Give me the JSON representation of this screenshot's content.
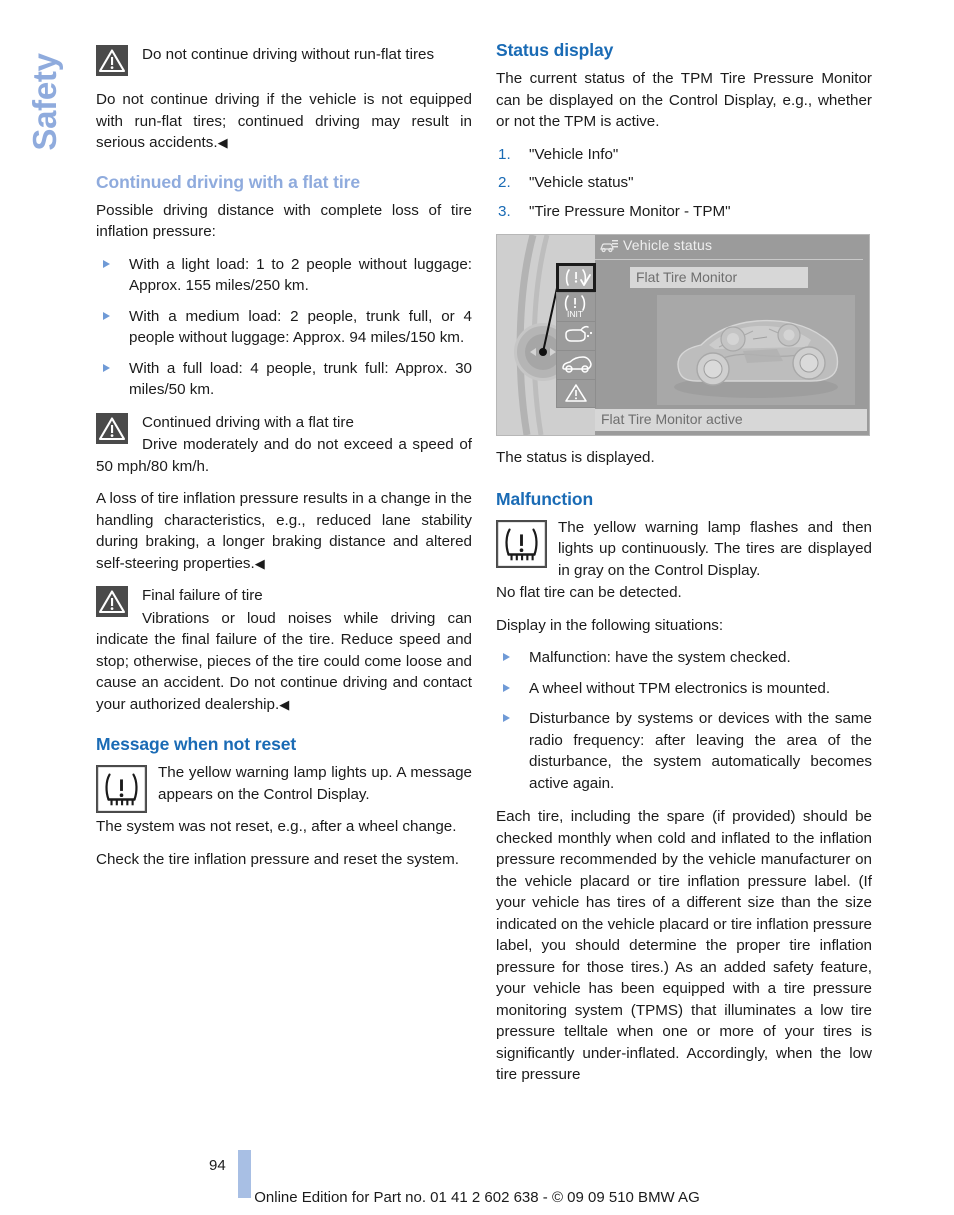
{
  "chapter_tab": {
    "label": "Safety"
  },
  "left_column": {
    "warning_runflat": {
      "icon": "warning-triangle-icon",
      "title": "Do not continue driving without run-flat tires",
      "body": "Do not continue driving if the vehicle is not equipped with run-flat tires; continued driving may result in serious accidents.",
      "endmark": "◀"
    },
    "heading_continued_driving": "Continued driving with a flat tire",
    "intro": "Possible driving distance with complete loss of tire inflation pressure:",
    "bullets": [
      "With a light load: 1 to 2 people without luggage: Approx. 155 miles/250 km.",
      "With a medium load: 2 people, trunk full, or 4 people without luggage: Approx. 94 miles/150 km.",
      "With a full load: 4 people, trunk full: Approx. 30 miles/50 km."
    ],
    "warning_continued": {
      "icon": "warning-triangle-icon",
      "title": "Continued driving with a flat tire",
      "body": "Drive moderately and do not exceed a speed of 50 mph/80 km/h."
    },
    "loss_paragraph": "A loss of tire inflation pressure results in a change in the handling characteristics, e.g., reduced lane stability during braking, a longer braking distance and altered self-steering properties.",
    "loss_endmark": "◀",
    "warning_final_failure": {
      "icon": "warning-triangle-icon",
      "title": "Final failure of tire",
      "body": "Vibrations or loud noises while driving can indicate the final failure of the tire. Reduce speed and stop; otherwise, pieces of the tire could come loose and cause an accident. Do not continue driving and contact your authorized dealership.",
      "endmark": "◀"
    },
    "heading_message_not_reset": "Message when not reset",
    "tpms_message": {
      "icon": "tpms-telltale-icon",
      "text": "The yellow warning lamp lights up. A message appears on the Control Display."
    },
    "not_reset_paragraph": "The system was not reset, e.g., after a wheel change.",
    "check_paragraph": "Check the tire inflation pressure and reset the system."
  },
  "right_column": {
    "heading_status_display": "Status display",
    "status_intro": "The current status of the TPM Tire Pressure Monitor can be displayed on the Control Display, e.g., whether or not the TPM is active.",
    "steps": [
      {
        "num": "1.",
        "label": "\"Vehicle Info\""
      },
      {
        "num": "2.",
        "label": "\"Vehicle status\""
      },
      {
        "num": "3.",
        "label": "\"Tire Pressure Monitor - TPM\""
      }
    ],
    "control_display": {
      "title": "Vehicle status",
      "title_icon": "vehicle-status-icon",
      "selected_item": "Flat Tire Monitor",
      "status_text": "Flat Tire Monitor active",
      "icons": [
        "flat-tire-monitor-icon",
        "tpm-init-icon",
        "engine-oil-icon",
        "vehicle-check-icon",
        "warning-triangle-icon"
      ],
      "controller": "idrive-controller-knob"
    },
    "status_displayed": "The status is displayed.",
    "heading_malfunction": "Malfunction",
    "tpms_malfunction": {
      "icon": "tpms-telltale-icon",
      "text": "The yellow warning lamp flashes and then lights up continuously. The tires are displayed in gray on the Control Display."
    },
    "no_flat_detected": "No flat tire can be detected.",
    "display_situations_intro": "Display in the following situations:",
    "bullets": [
      "Malfunction: have the system checked.",
      "A wheel without TPM electronics is mounted.",
      "Disturbance by systems or devices with the same radio frequency: after leaving the area of the disturbance, the system automatically becomes active again."
    ],
    "tpms_legal": "Each tire, including the spare (if provided) should be checked monthly when cold and inflated to the inflation pressure recommended by the vehicle manufacturer on the vehicle placard or tire inflation pressure label. (If your vehicle has tires of a different size than the size indicated on the vehicle placard or tire inflation pressure label, you should determine the proper tire inflation pressure for those tires.) As an added safety feature, your vehicle has been equipped with a tire pressure monitoring system (TPMS) that illuminates a low tire pressure telltale when one or more of your tires is significantly under-inflated. Accordingly, when the low tire pressure"
  },
  "footer": {
    "page_number": "94",
    "edition": "Online Edition for Part no. 01 41 2 602 638 - © 09 09 510 BMW AG"
  },
  "colors": {
    "heading_strong": "#1a6bb5",
    "heading_light": "#8fabdd",
    "bullet": "#6f9ad6",
    "warning_icon_bg": "#4a4a4a",
    "tab": "#a8bfe4",
    "text": "#1b1b1b"
  }
}
